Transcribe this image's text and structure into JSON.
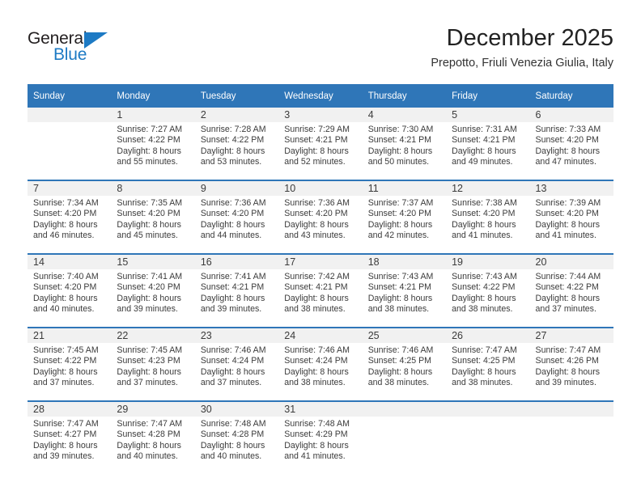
{
  "brand": {
    "name_top": "General",
    "name_bottom": "Blue",
    "accent_color": "#1d7ac4"
  },
  "header": {
    "title": "December 2025",
    "subtitle": "Prepotto, Friuli Venezia Giulia, Italy"
  },
  "theme": {
    "header_blue": "#2f76b8",
    "daynum_band": "#f1f1f1",
    "text": "#3b3b3b"
  },
  "weekday_headers": [
    "Sunday",
    "Monday",
    "Tuesday",
    "Wednesday",
    "Thursday",
    "Friday",
    "Saturday"
  ],
  "weeks": [
    [
      {
        "day": "",
        "sunrise": "",
        "sunset": "",
        "daylight_1": "",
        "daylight_2": ""
      },
      {
        "day": "1",
        "sunrise": "Sunrise: 7:27 AM",
        "sunset": "Sunset: 4:22 PM",
        "daylight_1": "Daylight: 8 hours",
        "daylight_2": "and 55 minutes."
      },
      {
        "day": "2",
        "sunrise": "Sunrise: 7:28 AM",
        "sunset": "Sunset: 4:22 PM",
        "daylight_1": "Daylight: 8 hours",
        "daylight_2": "and 53 minutes."
      },
      {
        "day": "3",
        "sunrise": "Sunrise: 7:29 AM",
        "sunset": "Sunset: 4:21 PM",
        "daylight_1": "Daylight: 8 hours",
        "daylight_2": "and 52 minutes."
      },
      {
        "day": "4",
        "sunrise": "Sunrise: 7:30 AM",
        "sunset": "Sunset: 4:21 PM",
        "daylight_1": "Daylight: 8 hours",
        "daylight_2": "and 50 minutes."
      },
      {
        "day": "5",
        "sunrise": "Sunrise: 7:31 AM",
        "sunset": "Sunset: 4:21 PM",
        "daylight_1": "Daylight: 8 hours",
        "daylight_2": "and 49 minutes."
      },
      {
        "day": "6",
        "sunrise": "Sunrise: 7:33 AM",
        "sunset": "Sunset: 4:20 PM",
        "daylight_1": "Daylight: 8 hours",
        "daylight_2": "and 47 minutes."
      }
    ],
    [
      {
        "day": "7",
        "sunrise": "Sunrise: 7:34 AM",
        "sunset": "Sunset: 4:20 PM",
        "daylight_1": "Daylight: 8 hours",
        "daylight_2": "and 46 minutes."
      },
      {
        "day": "8",
        "sunrise": "Sunrise: 7:35 AM",
        "sunset": "Sunset: 4:20 PM",
        "daylight_1": "Daylight: 8 hours",
        "daylight_2": "and 45 minutes."
      },
      {
        "day": "9",
        "sunrise": "Sunrise: 7:36 AM",
        "sunset": "Sunset: 4:20 PM",
        "daylight_1": "Daylight: 8 hours",
        "daylight_2": "and 44 minutes."
      },
      {
        "day": "10",
        "sunrise": "Sunrise: 7:36 AM",
        "sunset": "Sunset: 4:20 PM",
        "daylight_1": "Daylight: 8 hours",
        "daylight_2": "and 43 minutes."
      },
      {
        "day": "11",
        "sunrise": "Sunrise: 7:37 AM",
        "sunset": "Sunset: 4:20 PM",
        "daylight_1": "Daylight: 8 hours",
        "daylight_2": "and 42 minutes."
      },
      {
        "day": "12",
        "sunrise": "Sunrise: 7:38 AM",
        "sunset": "Sunset: 4:20 PM",
        "daylight_1": "Daylight: 8 hours",
        "daylight_2": "and 41 minutes."
      },
      {
        "day": "13",
        "sunrise": "Sunrise: 7:39 AM",
        "sunset": "Sunset: 4:20 PM",
        "daylight_1": "Daylight: 8 hours",
        "daylight_2": "and 41 minutes."
      }
    ],
    [
      {
        "day": "14",
        "sunrise": "Sunrise: 7:40 AM",
        "sunset": "Sunset: 4:20 PM",
        "daylight_1": "Daylight: 8 hours",
        "daylight_2": "and 40 minutes."
      },
      {
        "day": "15",
        "sunrise": "Sunrise: 7:41 AM",
        "sunset": "Sunset: 4:20 PM",
        "daylight_1": "Daylight: 8 hours",
        "daylight_2": "and 39 minutes."
      },
      {
        "day": "16",
        "sunrise": "Sunrise: 7:41 AM",
        "sunset": "Sunset: 4:21 PM",
        "daylight_1": "Daylight: 8 hours",
        "daylight_2": "and 39 minutes."
      },
      {
        "day": "17",
        "sunrise": "Sunrise: 7:42 AM",
        "sunset": "Sunset: 4:21 PM",
        "daylight_1": "Daylight: 8 hours",
        "daylight_2": "and 38 minutes."
      },
      {
        "day": "18",
        "sunrise": "Sunrise: 7:43 AM",
        "sunset": "Sunset: 4:21 PM",
        "daylight_1": "Daylight: 8 hours",
        "daylight_2": "and 38 minutes."
      },
      {
        "day": "19",
        "sunrise": "Sunrise: 7:43 AM",
        "sunset": "Sunset: 4:22 PM",
        "daylight_1": "Daylight: 8 hours",
        "daylight_2": "and 38 minutes."
      },
      {
        "day": "20",
        "sunrise": "Sunrise: 7:44 AM",
        "sunset": "Sunset: 4:22 PM",
        "daylight_1": "Daylight: 8 hours",
        "daylight_2": "and 37 minutes."
      }
    ],
    [
      {
        "day": "21",
        "sunrise": "Sunrise: 7:45 AM",
        "sunset": "Sunset: 4:22 PM",
        "daylight_1": "Daylight: 8 hours",
        "daylight_2": "and 37 minutes."
      },
      {
        "day": "22",
        "sunrise": "Sunrise: 7:45 AM",
        "sunset": "Sunset: 4:23 PM",
        "daylight_1": "Daylight: 8 hours",
        "daylight_2": "and 37 minutes."
      },
      {
        "day": "23",
        "sunrise": "Sunrise: 7:46 AM",
        "sunset": "Sunset: 4:24 PM",
        "daylight_1": "Daylight: 8 hours",
        "daylight_2": "and 37 minutes."
      },
      {
        "day": "24",
        "sunrise": "Sunrise: 7:46 AM",
        "sunset": "Sunset: 4:24 PM",
        "daylight_1": "Daylight: 8 hours",
        "daylight_2": "and 38 minutes."
      },
      {
        "day": "25",
        "sunrise": "Sunrise: 7:46 AM",
        "sunset": "Sunset: 4:25 PM",
        "daylight_1": "Daylight: 8 hours",
        "daylight_2": "and 38 minutes."
      },
      {
        "day": "26",
        "sunrise": "Sunrise: 7:47 AM",
        "sunset": "Sunset: 4:25 PM",
        "daylight_1": "Daylight: 8 hours",
        "daylight_2": "and 38 minutes."
      },
      {
        "day": "27",
        "sunrise": "Sunrise: 7:47 AM",
        "sunset": "Sunset: 4:26 PM",
        "daylight_1": "Daylight: 8 hours",
        "daylight_2": "and 39 minutes."
      }
    ],
    [
      {
        "day": "28",
        "sunrise": "Sunrise: 7:47 AM",
        "sunset": "Sunset: 4:27 PM",
        "daylight_1": "Daylight: 8 hours",
        "daylight_2": "and 39 minutes."
      },
      {
        "day": "29",
        "sunrise": "Sunrise: 7:47 AM",
        "sunset": "Sunset: 4:28 PM",
        "daylight_1": "Daylight: 8 hours",
        "daylight_2": "and 40 minutes."
      },
      {
        "day": "30",
        "sunrise": "Sunrise: 7:48 AM",
        "sunset": "Sunset: 4:28 PM",
        "daylight_1": "Daylight: 8 hours",
        "daylight_2": "and 40 minutes."
      },
      {
        "day": "31",
        "sunrise": "Sunrise: 7:48 AM",
        "sunset": "Sunset: 4:29 PM",
        "daylight_1": "Daylight: 8 hours",
        "daylight_2": "and 41 minutes."
      },
      {
        "day": "",
        "sunrise": "",
        "sunset": "",
        "daylight_1": "",
        "daylight_2": ""
      },
      {
        "day": "",
        "sunrise": "",
        "sunset": "",
        "daylight_1": "",
        "daylight_2": ""
      },
      {
        "day": "",
        "sunrise": "",
        "sunset": "",
        "daylight_1": "",
        "daylight_2": ""
      }
    ]
  ]
}
